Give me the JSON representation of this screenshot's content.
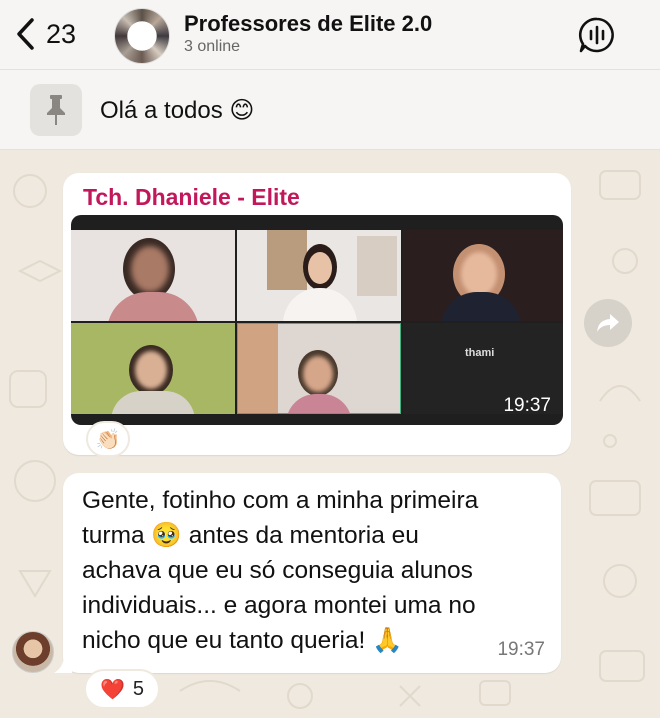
{
  "header": {
    "back_count": "23",
    "title": "Professores de Elite 2.0",
    "subtitle": "3 online",
    "back_icon": "chevron-left-icon",
    "voice_icon": "voice-chat-icon"
  },
  "pinned": {
    "icon": "pin-icon",
    "text": "Olá a todos 😊"
  },
  "messages": [
    {
      "type": "photo",
      "sender": "Tch. Dhaniele - Elite",
      "sender_color": "#c2185b",
      "time": "19:37",
      "tile_label": "thami",
      "reaction": {
        "emoji": "👏🏻"
      }
    },
    {
      "type": "text",
      "text_lines": [
        "Gente, fotinho com a minha primeira",
        "turma 🥹 antes da mentoria eu",
        "achava que eu só conseguia alunos",
        "individuais... e agora montei uma no",
        "nicho que eu tanto queria! 🙏"
      ],
      "time": "19:37",
      "reaction": {
        "emoji": "❤️",
        "count": "5"
      }
    }
  ],
  "colors": {
    "chat_background": "#efe9df",
    "header_background": "#f6f5f3",
    "bubble": "#ffffff"
  }
}
